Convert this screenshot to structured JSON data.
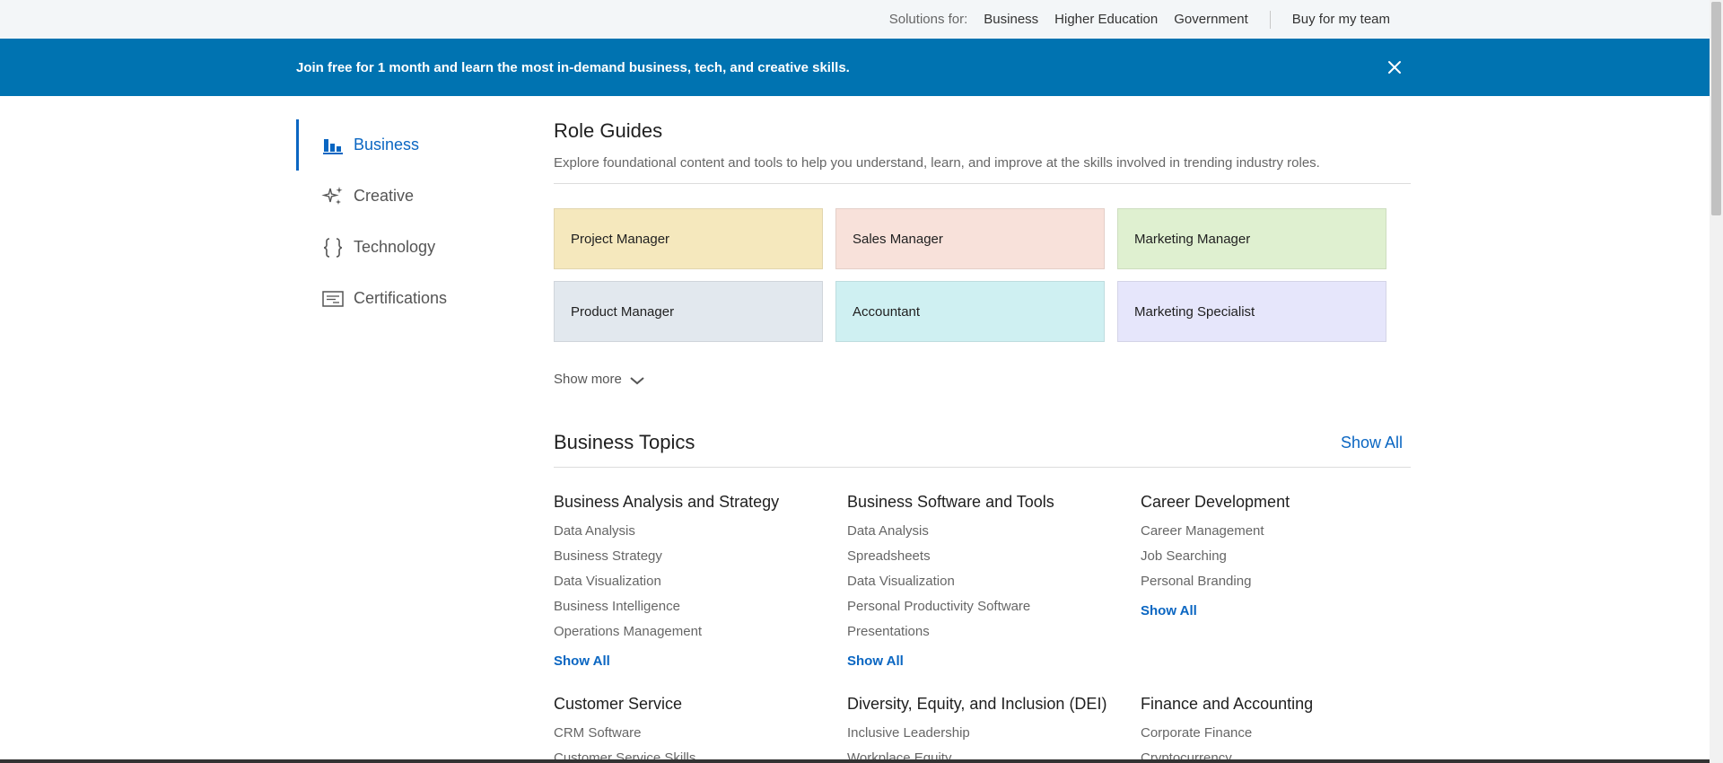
{
  "topbar": {
    "solutions_label": "Solutions for:",
    "links": [
      "Business",
      "Higher Education",
      "Government"
    ],
    "buy": "Buy for my team"
  },
  "banner": {
    "text": "Join free for 1 month and learn the most in-demand business, tech, and creative skills.",
    "close_icon": "close-icon"
  },
  "sidenav": {
    "items": [
      {
        "label": "Business",
        "icon": "bar-chart-icon",
        "active": true
      },
      {
        "label": "Creative",
        "icon": "sparkle-icon",
        "active": false
      },
      {
        "label": "Technology",
        "icon": "braces-icon",
        "active": false
      },
      {
        "label": "Certifications",
        "icon": "certificate-icon",
        "active": false
      }
    ]
  },
  "role_guides": {
    "title": "Role Guides",
    "description": "Explore foundational content and tools to help you understand, learn, and improve at the skills involved in trending industry roles.",
    "cards": [
      {
        "label": "Project Manager",
        "color": "#f5e8bd"
      },
      {
        "label": "Sales Manager",
        "color": "#f8e1da"
      },
      {
        "label": "Marketing Manager",
        "color": "#dff0d0"
      },
      {
        "label": "Product Manager",
        "color": "#e2e8ee"
      },
      {
        "label": "Accountant",
        "color": "#cff0f2"
      },
      {
        "label": "Marketing Specialist",
        "color": "#e6e6fb"
      }
    ],
    "show_more": "Show more"
  },
  "business_topics": {
    "title": "Business Topics",
    "show_all": "Show All",
    "columns": [
      {
        "title": "Business Analysis and Strategy",
        "links": [
          "Data Analysis",
          "Business Strategy",
          "Data Visualization",
          "Business Intelligence",
          "Operations Management"
        ],
        "show_all": "Show All"
      },
      {
        "title": "Business Software and Tools",
        "links": [
          "Data Analysis",
          "Spreadsheets",
          "Data Visualization",
          "Personal Productivity Software",
          "Presentations"
        ],
        "show_all": "Show All"
      },
      {
        "title": "Career Development",
        "links": [
          "Career Management",
          "Job Searching",
          "Personal Branding"
        ],
        "show_all": "Show All"
      },
      {
        "title": "Customer Service",
        "links": [
          "CRM Software",
          "Customer Service Skills"
        ],
        "show_all": ""
      },
      {
        "title": "Diversity, Equity, and Inclusion (DEI)",
        "links": [
          "Inclusive Leadership",
          "Workplace Equity"
        ],
        "show_all": ""
      },
      {
        "title": "Finance and Accounting",
        "links": [
          "Corporate Finance",
          "Cryptocurrency"
        ],
        "show_all": ""
      }
    ]
  },
  "colors": {
    "accent": "#0a66c2",
    "banner": "#0073b1"
  }
}
